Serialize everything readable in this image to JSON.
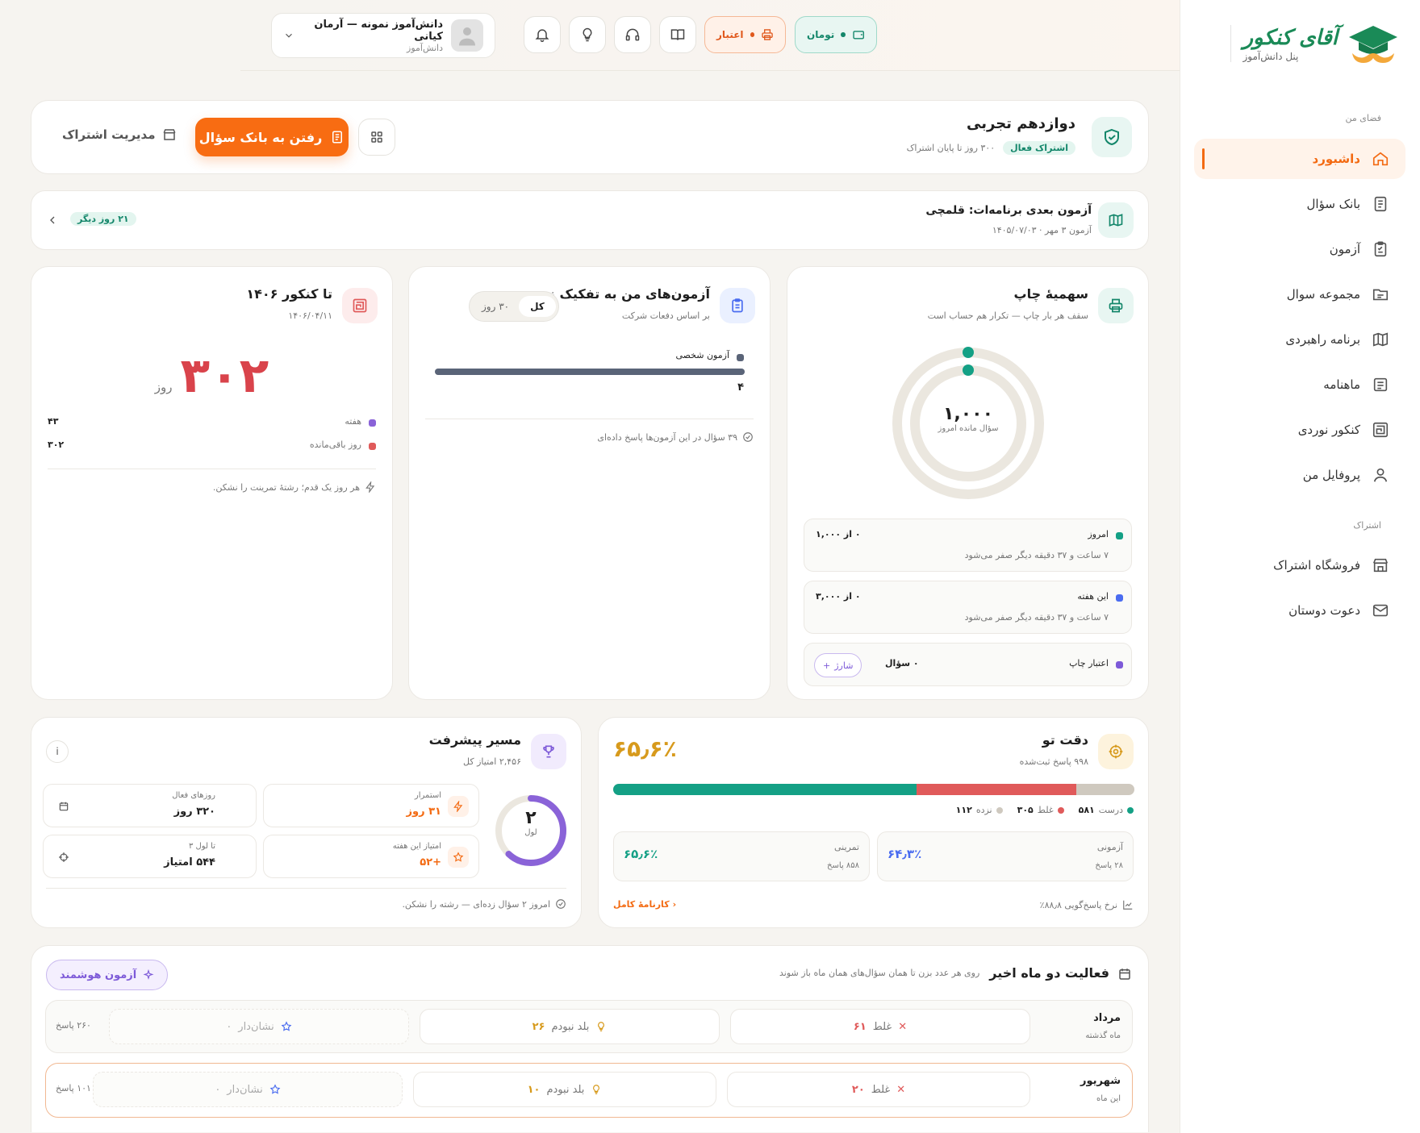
{
  "brand": {
    "name": "آقای کنکور",
    "subtitle": "پنل دانش‌آموز"
  },
  "sidebar": {
    "section_main": "فضای من",
    "section_sub": "اشتراک",
    "items": [
      {
        "label": "داشبورد",
        "icon": "home-icon",
        "active": true
      },
      {
        "label": "بانک سؤال",
        "icon": "document-icon"
      },
      {
        "label": "آزمون",
        "icon": "clipboard-check-icon"
      },
      {
        "label": "مجموعه سوال",
        "icon": "folder-icon"
      },
      {
        "label": "برنامه راهبردی",
        "icon": "map-icon"
      },
      {
        "label": "ماهنامه",
        "icon": "newspaper-icon"
      },
      {
        "label": "کنکور نوردی",
        "icon": "maze-icon"
      },
      {
        "label": "پروفایل من",
        "icon": "user-icon"
      }
    ],
    "sub_items": [
      {
        "label": "فروشگاه اشتراک",
        "icon": "store-icon"
      },
      {
        "label": "دعوت دوستان",
        "icon": "mail-invite-icon"
      }
    ]
  },
  "topbar": {
    "user_name": "دانش‌آموز نمونه — آرمان کیانی",
    "user_role": "دانش‌آموز",
    "credit_label": "اعتبار",
    "toman_label": "تومان"
  },
  "subscription": {
    "title": "دوازدهم تجربی",
    "status": "اشتراک فعال",
    "remaining": "۳۰۰ روز تا پایان اشتراک",
    "cta": "رفتن به بانک سؤال",
    "manage": "مدیریت اشتراک"
  },
  "next_exam": {
    "title": "آزمون بعدی برنامه‌ات: قلمچی",
    "sub": "آزمون ۳ مهر · ۱۴۰۵/۰۷/۰۳",
    "badge": "۲۱ روز دیگر"
  },
  "print_quota": {
    "title": "سهمیهٔ چاپ",
    "subtitle": "سقف هر بار چاپ — تکرار هم حساب است",
    "center_value": "۱,۰۰۰",
    "center_label": "سؤال مانده امروز",
    "today": {
      "label": "امروز",
      "value": "۰ از ۱,۰۰۰",
      "note": "۷ ساعت و ۳۷ دقیقه دیگر صفر می‌شود",
      "color": "#14a085"
    },
    "week": {
      "label": "این هفته",
      "value": "۰ از ۳,۰۰۰",
      "note": "۷ ساعت و ۳۷ دقیقه دیگر صفر می‌شود",
      "color": "#4a6cf0"
    },
    "credit": {
      "label": "اعتبار چاپ",
      "value": "۰ سؤال",
      "button": "شارژ",
      "color": "#7d5ad8"
    }
  },
  "exams_by_type": {
    "title": "آزمون‌های من به تفکیک نوع",
    "subtitle": "بر اساس دفعات شرکت",
    "toggle_all": "کل",
    "toggle_30": "۳۰ روز",
    "bars": [
      {
        "label": "آزمون شخصی",
        "value": "۴",
        "fraction": 1.0
      }
    ],
    "footer": "۳۹ سؤال در این آزمون‌ها پاسخ داده‌ای"
  },
  "konkur": {
    "title": "تا کنکور ۱۴۰۶",
    "date": "۱۴۰۶/۰۴/۱۱",
    "days": "۳۰۲",
    "unit": "روز",
    "rows": [
      {
        "label": "هفته",
        "value": "۴۳",
        "color": "#8a63d8"
      },
      {
        "label": "روز باقی‌مانده",
        "value": "۳۰۲",
        "color": "#e05a5a"
      }
    ],
    "footer": "هر روز یک قدم؛ رشتهٔ تمرینت را نشکن."
  },
  "accuracy": {
    "title": "دقت تو",
    "subtitle": "۹۹۸ پاسخ ثبت‌شده",
    "percent": "۶۵٫۶٪",
    "segments": [
      {
        "label": "درست",
        "value": "۵۸۱",
        "count": 581,
        "color": "#14a085"
      },
      {
        "label": "غلط",
        "value": "۳۰۵",
        "count": 305,
        "color": "#e05a5a"
      },
      {
        "label": "نزده",
        "value": "۱۱۲",
        "count": 112,
        "color": "#cfc9bf"
      }
    ],
    "exam": {
      "label": "آزمونی",
      "percent": "۶۴٫۳٪",
      "answers": "۲۸ پاسخ"
    },
    "practice": {
      "label": "تمرینی",
      "percent": "۶۵٫۶٪",
      "answers": "۸۵۸ پاسخ"
    },
    "response_rate": "نرخ پاسخ‌گویی ۸۸٫۸٪",
    "report_link": "کارنامهٔ کامل"
  },
  "progress": {
    "title": "مسیر پیشرفت",
    "subtitle": "۲,۴۵۶ امتیاز کل",
    "level": "۲",
    "level_label": "لول",
    "level_fraction": 0.62,
    "stats": [
      {
        "label": "استمرار",
        "value": "۳۱ روز",
        "icon": "bolt-icon"
      },
      {
        "label": "روزهای فعال",
        "value": "۳۲۰ روز",
        "icon": "calendar-icon"
      },
      {
        "label": "امتیاز این هفته",
        "value": "+۵۲",
        "icon": "star-icon"
      },
      {
        "label": "تا لول ۳",
        "value": "۵۴۴ امتیاز",
        "icon": "target-icon"
      }
    ],
    "footer": "امروز ۲ سؤال زده‌ای — رشته را نشکن."
  },
  "activity": {
    "title": "فعالیت دو ماه اخیر",
    "hint": "روی هر عدد بزن تا همان سؤال‌های همان ماه باز شوند",
    "smart_button": "آزمون هوشمند",
    "rows": [
      {
        "month": "مرداد",
        "tag": "ماه گذشته",
        "wrong_label": "غلط",
        "wrong": "۶۱",
        "know_label": "بلد نبودم",
        "know": "۲۶",
        "marked_label": "نشان‌دار",
        "marked": "۰",
        "answers": "۲۶۰ پاسخ"
      },
      {
        "month": "شهریور",
        "tag": "این ماه",
        "wrong_label": "غلط",
        "wrong": "۲۰",
        "know_label": "بلد نبودم",
        "know": "۱۰",
        "marked_label": "نشان‌دار",
        "marked": "۰",
        "answers": "۱۰۱ پاسخ"
      }
    ]
  }
}
